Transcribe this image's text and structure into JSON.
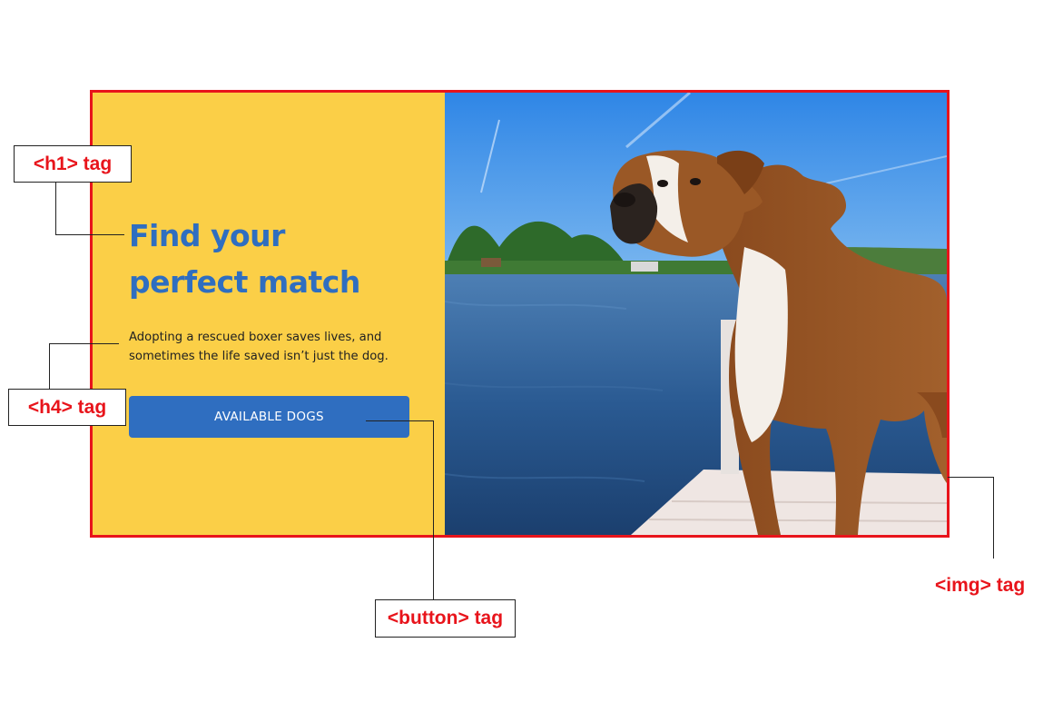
{
  "hero": {
    "title_line1": "Find your",
    "title_line2": "perfect match",
    "subtitle_line1": "Adopting a rescued boxer saves lives, and",
    "subtitle_line2": "sometimes the life saved isn’t just the dog.",
    "cta_label": "AVAILABLE DOGS",
    "image_alt": "Boxer dog standing on a dock by a lake"
  },
  "annotations": {
    "h1_label": "<h1> tag",
    "h4_label": "<h4> tag",
    "button_label": "<button> tag",
    "img_label": "<img> tag"
  },
  "colors": {
    "panel_background": "#fbcf47",
    "brand_blue": "#2f6ec0",
    "annotation_red": "#e8141b"
  }
}
